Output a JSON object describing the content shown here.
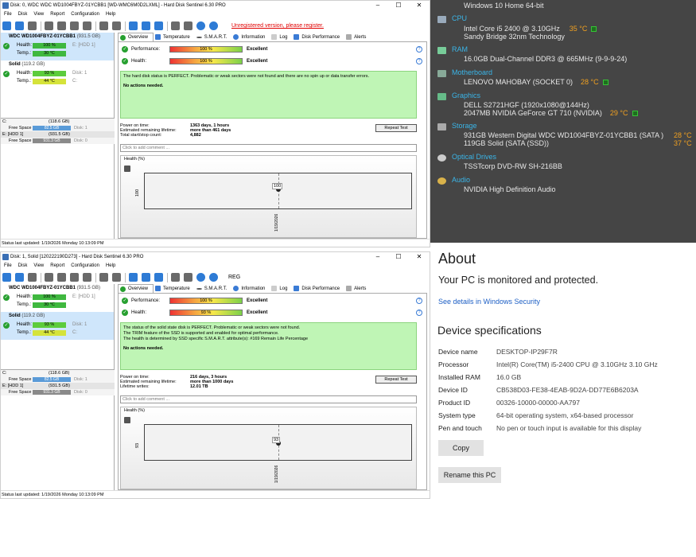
{
  "hds_top": {
    "title": "Disk: 0, WDC WDC WD1004FBYZ-01YCBB1 [WD-WMC6M0D2LXML]  -  Hard Disk Sentinel 6.30 PRO",
    "register_text": "",
    "warning_link": "Unregistered version, please register.",
    "menu": [
      "File",
      "Disk",
      "View",
      "Report",
      "Configuration",
      "Help"
    ],
    "tabs": [
      "Overview",
      "Temperature",
      "S.M.A.R.T.",
      "Information",
      "Log",
      "Disk Performance",
      "Alerts"
    ],
    "disk1": {
      "name": "WDC WD1004FBYZ-01YCBB1",
      "size": "(931.5 GB)",
      "health": "100 %",
      "temp": "30 °C",
      "health_note": "E: [HDD 1]"
    },
    "disk2": {
      "name": "Solid",
      "size": "(119.2 GB)",
      "health": "93 %",
      "temp": "44 °C",
      "health_note": "Disk: 1",
      "temp_note": "C:"
    },
    "parts": [
      {
        "drive": "C:",
        "size": "(118.6 GB)",
        "free_label": "Free Space",
        "free": "82.5 GB",
        "disk": "Disk: 1"
      },
      {
        "drive": "E: [HDD 1]",
        "size": "(931.5 GB)",
        "free_label": "Free Space",
        "free": "931.3 GB",
        "disk": "Disk: 0"
      }
    ],
    "performance": {
      "label": "Performance:",
      "value": "100 %",
      "text": "Excellent"
    },
    "health": {
      "label": "Health:",
      "value": "100 %",
      "text": "Excellent"
    },
    "message": "The hard disk status is PERFECT. Problematic or weak sectors were not found and there are no spin up or data transfer errors.",
    "no_actions": "No actions needed.",
    "info": [
      {
        "k": "Power on time:",
        "v": "1363 days, 1 hours"
      },
      {
        "k": "Estimated remaining lifetime:",
        "v": "more than 461 days"
      },
      {
        "k": "Total start/stop count:",
        "v": "4,882"
      }
    ],
    "repeat_test": "Repeat Test",
    "comment_placeholder": "Click to add comment ...",
    "health_tab": "Health (%)",
    "chart_y": "100",
    "chart_point": "100",
    "chart_x": "1/19/2026",
    "status": "Status last updated: 1/19/2026 Monday 10:13:09 PM"
  },
  "hds_bottom": {
    "title": "Disk: 1, Solid [120222190D273]  -  Hard Disk Sentinel 6.30 PRO",
    "register_text": "REG",
    "menu": [
      "File",
      "Disk",
      "View",
      "Report",
      "Configuration",
      "Help"
    ],
    "tabs": [
      "Overview",
      "Temperature",
      "S.M.A.R.T.",
      "Information",
      "Log",
      "Disk Performance",
      "Alerts"
    ],
    "disk1": {
      "name": "WDC WD1004FBYZ-01YCBB1",
      "size": "(931.5 GB)",
      "health": "100 %",
      "temp": "30 °C",
      "health_note": "E: [HDD 1]"
    },
    "disk2": {
      "name": "Solid",
      "size": "(119.2 GB)",
      "health": "93 %",
      "temp": "44 °C",
      "health_note": "Disk: 1",
      "temp_note": "C:"
    },
    "parts": [
      {
        "drive": "C:",
        "size": "(118.6 GB)",
        "free_label": "Free Space",
        "free": "82.5 GB",
        "disk": "Disk: 1"
      },
      {
        "drive": "E: [HDD 1]",
        "size": "(931.5 GB)",
        "free_label": "Free Space",
        "free": "931.3 GB",
        "disk": "Disk: 0"
      }
    ],
    "performance": {
      "label": "Performance:",
      "value": "100 %",
      "text": "Excellent"
    },
    "health": {
      "label": "Health:",
      "value": "93 %",
      "text": "Excellent"
    },
    "message1": "The status of the solid state disk is PERFECT. Problematic or weak sectors were not found.",
    "message2": "The TRIM feature of the SSD is supported and enabled for optimal performance.",
    "message3": "The health is determined by SSD specific S.M.A.R.T. attribute(s): #169 Remain Life Percentage",
    "no_actions": "No actions needed.",
    "info": [
      {
        "k": "Power on time:",
        "v": "216 days, 3 hours"
      },
      {
        "k": "Estimated remaining lifetime:",
        "v": "more than 1000 days"
      },
      {
        "k": "Lifetime writes:",
        "v": "12.01 TB"
      }
    ],
    "repeat_test": "Repeat Test",
    "comment_placeholder": "Click to add comment ...",
    "health_tab": "Health (%)",
    "chart_y": "93",
    "chart_point": "93",
    "chart_x": "1/19/2026",
    "status": "Status last updated: 1/19/2026 Monday 10:13:09 PM"
  },
  "speccy": {
    "os_line": "Windows 10 Home 64-bit",
    "cpu": {
      "title": "CPU",
      "l1": "Intel Core i5 2400 @ 3.10GHz",
      "temp": "35 °C",
      "l2": "Sandy Bridge 32nm Technology"
    },
    "ram": {
      "title": "RAM",
      "l1": "16.0GB Dual-Channel DDR3 @ 665MHz (9-9-9-24)"
    },
    "mb": {
      "title": "Motherboard",
      "l1": "LENOVO MAHOBAY (SOCKET 0)",
      "temp": "28 °C"
    },
    "gfx": {
      "title": "Graphics",
      "l1": "DELL S2721HGF (1920x1080@144Hz)",
      "l2": "2047MB NVIDIA GeForce GT 710 (NVIDIA)",
      "temp": "29 °C"
    },
    "storage": {
      "title": "Storage",
      "l1": "931GB Western Digital WDC WD1004FBYZ-01YCBB1 (SATA )",
      "t1": "28 °C",
      "l2": "119GB Solid (SATA (SSD))",
      "t2": "37 °C"
    },
    "optical": {
      "title": "Optical Drives",
      "l1": "TSSTcorp DVD-RW SH-216BB"
    },
    "audio": {
      "title": "Audio",
      "l1": "NVIDIA High Definition Audio"
    }
  },
  "about": {
    "title": "About",
    "protected": "Your PC is monitored and protected.",
    "link": "See details in Windows Security",
    "spec_title": "Device specifications",
    "specs": [
      {
        "k": "Device name",
        "v": "DESKTOP-IP29F7R"
      },
      {
        "k": "Processor",
        "v": "Intel(R) Core(TM) i5-2400 CPU @ 3.10GHz   3.10 GHz"
      },
      {
        "k": "Installed RAM",
        "v": "16.0 GB"
      },
      {
        "k": "Device ID",
        "v": "CB538D03-FE38-4EAB-9D2A-DD77E6B6203A"
      },
      {
        "k": "Product ID",
        "v": "00326-10000-00000-AA797"
      },
      {
        "k": "System type",
        "v": "64-bit operating system, x64-based processor"
      },
      {
        "k": "Pen and touch",
        "v": "No pen or touch input is available for this display"
      }
    ],
    "copy_button": "Copy",
    "rename_button": "Rename this PC"
  }
}
